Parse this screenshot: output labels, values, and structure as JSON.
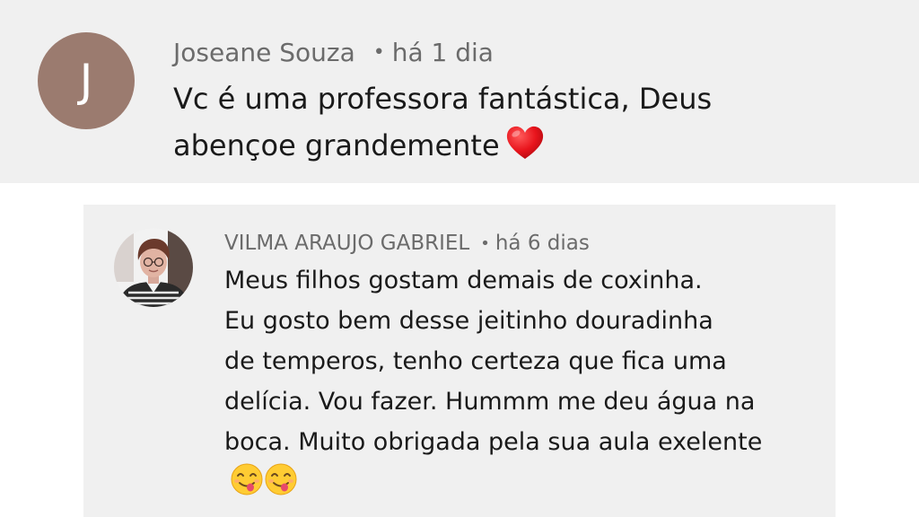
{
  "comment": {
    "avatar_letter": "J",
    "avatar_color": "#9b7b6f",
    "author": "Joseane Souza",
    "separator": "•",
    "time": "há 1 dia",
    "text_line1": "Vc é uma professora fantástica, Deus",
    "text_line2": "abençoe grandemente",
    "emoji": "heart-emoji"
  },
  "reply": {
    "author": "VILMA ARAUJO GABRIEL",
    "separator": "•",
    "time": "há 6 dias",
    "lines": [
      "Meus filhos gostam demais de coxinha.",
      "Eu gosto bem desse jeitinho douradinha",
      "de temperos, tenho certeza que fica uma",
      "delícia. Vou fazer. Hummm me deu água na",
      "boca. Muito obrigada pela sua aula exelente"
    ],
    "emojis": [
      "savoring-food-emoji",
      "savoring-food-emoji"
    ]
  }
}
